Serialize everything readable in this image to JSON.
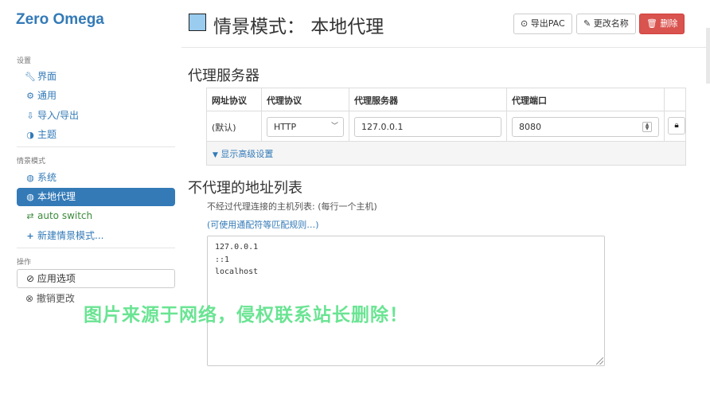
{
  "app": {
    "brand": "Zero Omega"
  },
  "sidebar": {
    "settings_header": "设置",
    "settings_items": [
      {
        "label": "界面",
        "icon": "wrench-icon"
      },
      {
        "label": "通用",
        "icon": "gear-icon"
      },
      {
        "label": "导入/导出",
        "icon": "import-export-icon"
      },
      {
        "label": "主题",
        "icon": "contrast-icon"
      }
    ],
    "profiles_header": "情景模式",
    "profile_items": [
      {
        "label": "系统",
        "icon": "globe-icon"
      },
      {
        "label": "本地代理",
        "icon": "globe-icon",
        "active": true
      },
      {
        "label": "auto switch",
        "icon": "auto-switch-icon"
      },
      {
        "label": "新建情景模式...",
        "icon": "plus-icon"
      }
    ],
    "actions_header": "操作",
    "apply_label": "应用选项",
    "undo_label": "撤销更改"
  },
  "header": {
    "title": "情景模式： 本地代理",
    "swatch_color": "#99ccee",
    "export_pac_label": "导出PAC",
    "rename_label": "更改名称",
    "delete_label": "删除"
  },
  "proxy": {
    "section_title": "代理服务器",
    "columns": {
      "scheme": "网址协议",
      "protocol": "代理协议",
      "server": "代理服务器",
      "port": "代理端口"
    },
    "row": {
      "scheme": "(默认)",
      "protocol": "HTTP",
      "server": "127.0.0.1",
      "port": "8080"
    },
    "advanced_label": "显示高级设置"
  },
  "bypass": {
    "section_title": "不代理的地址列表",
    "description": "不经过代理连接的主机列表: (每行一个主机)",
    "wildcard_link": "(可使用通配符等匹配规则…)",
    "lines": [
      "127.0.0.1",
      "::1",
      "localhost"
    ]
  },
  "watermark": "图片来源于网络，侵权联系站长删除！",
  "colors": {
    "accent": "#337ab7",
    "danger": "#d9534f",
    "watermark": "#5ee28a"
  }
}
